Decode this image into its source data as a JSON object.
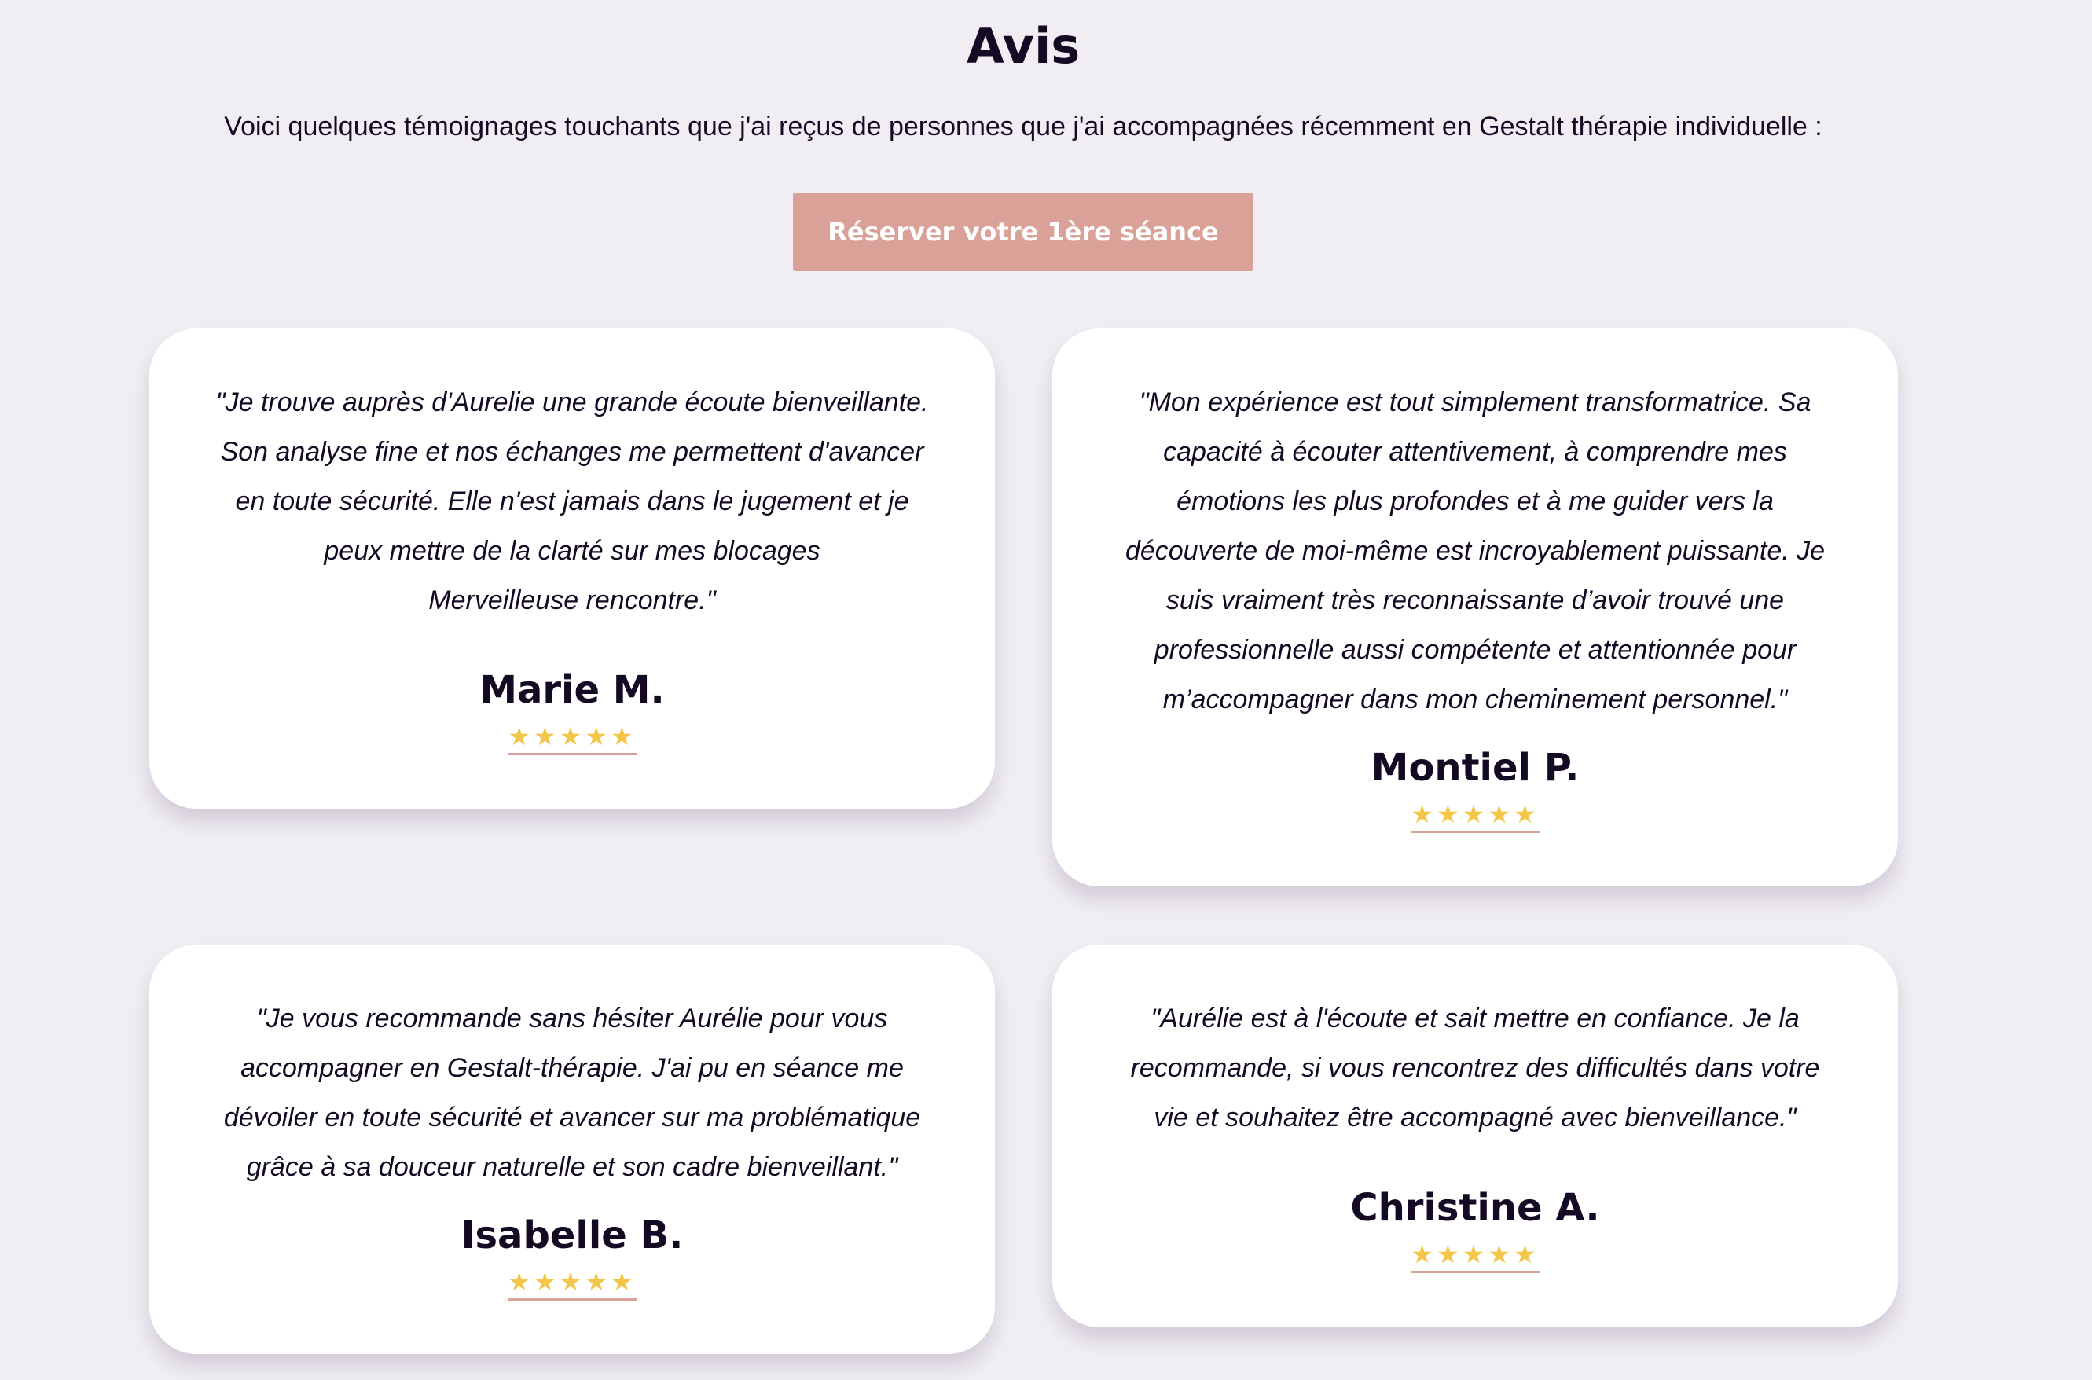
{
  "header": {
    "title": "Avis",
    "intro": "Voici quelques témoignages touchants que j'ai reçus de personnes que j'ai accompagnées récemment en Gestalt thérapie individuelle :",
    "cta_label": "Réserver votre 1ère séance"
  },
  "colors": {
    "background": "#f0edf3",
    "card": "#ffffff",
    "accent": "#d9a197",
    "text": "#150a23",
    "star": "#f3c64a"
  },
  "testimonials": [
    {
      "quote": "\"Je trouve auprès d'Aurelie une grande écoute bienveillante.\nSon analyse fine et nos échanges me permettent d'avancer\nen toute sécurité. Elle n'est jamais dans le jugement et je\npeux mettre de la clarté sur mes blocages\nMerveilleuse rencontre.\"",
      "name": "Marie M.",
      "stars": "★★★★★",
      "rating": 5
    },
    {
      "quote": "\"Mon expérience est tout simplement transformatrice. Sa\ncapacité à écouter attentivement, à comprendre mes\némotions les plus profondes et à me guider vers la\ndécouverte de moi-même est incroyablement puissante. Je\nsuis vraiment très reconnaissante d’avoir trouvé une\nprofessionnelle aussi compétente et attentionnée pour\nm’accompagner dans mon cheminement personnel.\"",
      "name": "Montiel P.",
      "stars": "★★★★★",
      "rating": 5
    },
    {
      "quote": "\"Je vous recommande sans hésiter Aurélie pour vous\naccompagner en Gestalt-thérapie. J'ai pu en séance me\ndévoiler en toute sécurité et avancer sur ma problématique\ngrâce à sa douceur naturelle et son cadre bienveillant.\"",
      "name": "Isabelle B.",
      "stars": "★★★★★",
      "rating": 5
    },
    {
      "quote": "\"Aurélie est à l'écoute et sait mettre en confiance. Je la\nrecommande, si vous rencontrez des difficultés dans votre\nvie et souhaitez être accompagné avec bienveillance.\"",
      "name": "Christine A.",
      "stars": "★★★★★",
      "rating": 5
    }
  ]
}
